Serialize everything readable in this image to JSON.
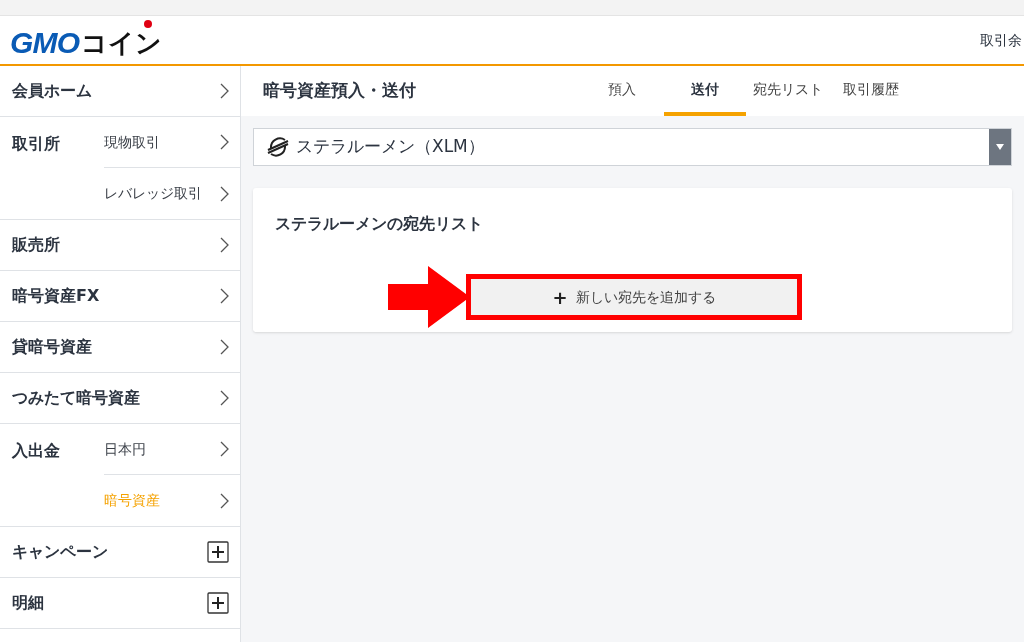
{
  "header": {
    "logo": {
      "part_1": "GMO",
      "part_2": "コイン"
    },
    "right_text": "取引余"
  },
  "sidebar": {
    "items": [
      {
        "kind": "link",
        "label": "会員ホーム"
      },
      {
        "kind": "group",
        "label": "取引所",
        "children": [
          {
            "label": "現物取引",
            "selected": false
          },
          {
            "label": "レバレッジ取引",
            "selected": false
          }
        ]
      },
      {
        "kind": "link",
        "label": "販売所"
      },
      {
        "kind": "link",
        "label": "暗号資産FX"
      },
      {
        "kind": "link",
        "label": "貸暗号資産"
      },
      {
        "kind": "link",
        "label": "つみたて暗号資産"
      },
      {
        "kind": "group",
        "label": "入出金",
        "children": [
          {
            "label": "日本円",
            "selected": false
          },
          {
            "label": "暗号資産",
            "selected": true
          }
        ]
      },
      {
        "kind": "expand",
        "label": "キャンペーン"
      },
      {
        "kind": "expand",
        "label": "明細"
      }
    ]
  },
  "page_title": "暗号資産預入・送付",
  "tabs": [
    {
      "label": "預入",
      "selected": false
    },
    {
      "label": "送付",
      "selected": true
    },
    {
      "label": "宛先リスト",
      "selected": false
    },
    {
      "label": "取引履歴",
      "selected": false
    }
  ],
  "currency_select": {
    "value": "ステラルーメン（XLM）"
  },
  "card": {
    "title": "ステラルーメンの宛先リスト",
    "button": "新しい宛先を追加する",
    "button_icon": "+"
  }
}
